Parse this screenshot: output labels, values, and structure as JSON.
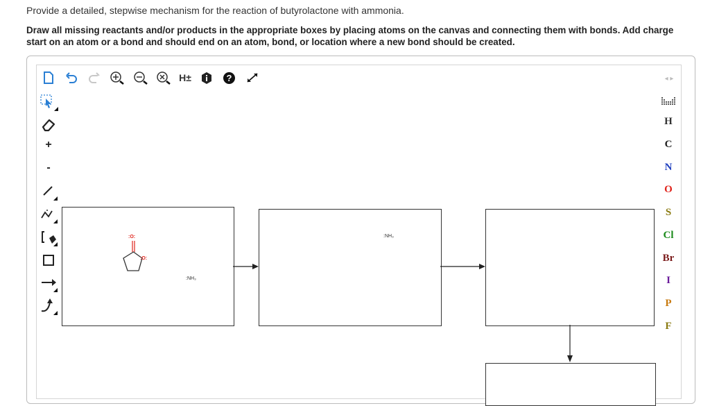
{
  "question": {
    "line1": "Provide a detailed, stepwise mechanism for the reaction of butyrolactone with ammonia.",
    "line2a": "Draw all missing reactants and/or products in the appropriate boxes by placing atoms on the canvas and connecting them with bonds. Add charge",
    "line2b": "start on an atom or a bond and should end on an atom, bond, or location where a new bond should be created."
  },
  "toolbar": {
    "items": [
      "new-document",
      "undo",
      "redo",
      "zoom-in",
      "zoom-out",
      "zoom-reset",
      "explicit-hydrogens",
      "info",
      "help",
      "fullscreen"
    ],
    "hydrogen_label": "H±"
  },
  "leftbar": {
    "plus_label": "+",
    "minus_label": "-"
  },
  "elements": [
    "H",
    "C",
    "N",
    "O",
    "S",
    "Cl",
    "Br",
    "I",
    "P",
    "F"
  ],
  "element_colors": {
    "H": "#333333",
    "C": "#222222",
    "N": "#1f3fbf",
    "O": "#e0231b",
    "S": "#8a7a10",
    "Cl": "#1a8a1a",
    "Br": "#7a1a1a",
    "I": "#6a1a9a",
    "P": "#c87a10",
    "F": "#8a7a10"
  },
  "molecules": {
    "ring_oxygen": "O",
    "carbonyl_oxygen": "O",
    "ammonia_box1": ":NH₃",
    "ammonia_box2": ":NH₃"
  }
}
